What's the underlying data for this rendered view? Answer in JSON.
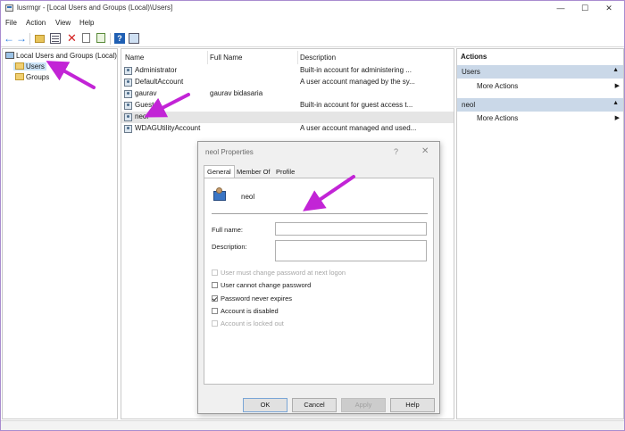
{
  "window": {
    "title": "lusrmgr - [Local Users and Groups (Local)\\Users]",
    "min_glyph": "—",
    "max_glyph": "☐",
    "close_glyph": "✕"
  },
  "menu": {
    "items": [
      "File",
      "Action",
      "View",
      "Help"
    ]
  },
  "toolbar": {
    "icons": [
      "back-arrow-icon",
      "forward-arrow-icon",
      "up-folder-icon",
      "show-hide-tree-icon",
      "delete-icon",
      "properties-icon",
      "export-list-icon",
      "help-icon",
      "view-icon"
    ]
  },
  "tree": {
    "root": "Local Users and Groups (Local)",
    "children": [
      "Users",
      "Groups"
    ],
    "selected": "Users"
  },
  "list": {
    "columns": [
      "Name",
      "Full Name",
      "Description"
    ],
    "rows": [
      {
        "name": "Administrator",
        "full_name": "",
        "description": "Built-in account for administering ..."
      },
      {
        "name": "DefaultAccount",
        "full_name": "",
        "description": "A user account managed by the sy..."
      },
      {
        "name": "gaurav",
        "full_name": "gaurav bidasaria",
        "description": ""
      },
      {
        "name": "Guest",
        "full_name": "",
        "description": "Built-in account for guest access t..."
      },
      {
        "name": "neol",
        "full_name": "",
        "description": ""
      },
      {
        "name": "WDAGUtilityAccount",
        "full_name": "",
        "description": "A user account managed and used..."
      }
    ],
    "highlighted_row": "neol"
  },
  "actions": {
    "header": "Actions",
    "sections": [
      {
        "title": "Users",
        "items": [
          "More Actions"
        ]
      },
      {
        "title": "neol",
        "items": [
          "More Actions"
        ]
      }
    ]
  },
  "dialog": {
    "title": "neol Properties",
    "help_glyph": "?",
    "close_glyph": "✕",
    "tabs": [
      "General",
      "Member Of",
      "Profile"
    ],
    "active_tab": "General",
    "username": "neol",
    "full_name_label": "Full name:",
    "full_name_value": "",
    "description_label": "Description:",
    "description_value": "",
    "checkboxes": [
      {
        "label": "User must change password at next logon",
        "checked": false,
        "enabled": false
      },
      {
        "label": "User cannot change password",
        "checked": false,
        "enabled": true
      },
      {
        "label": "Password never expires",
        "checked": true,
        "enabled": true
      },
      {
        "label": "Account is disabled",
        "checked": false,
        "enabled": true
      },
      {
        "label": "Account is locked out",
        "checked": false,
        "enabled": false
      }
    ],
    "buttons": {
      "ok": "OK",
      "cancel": "Cancel",
      "apply": "Apply",
      "help": "Help"
    }
  },
  "colors": {
    "annotation_arrow": "#c224d6",
    "selection": "#cce4f7",
    "actions_section": "#cad8e8"
  }
}
